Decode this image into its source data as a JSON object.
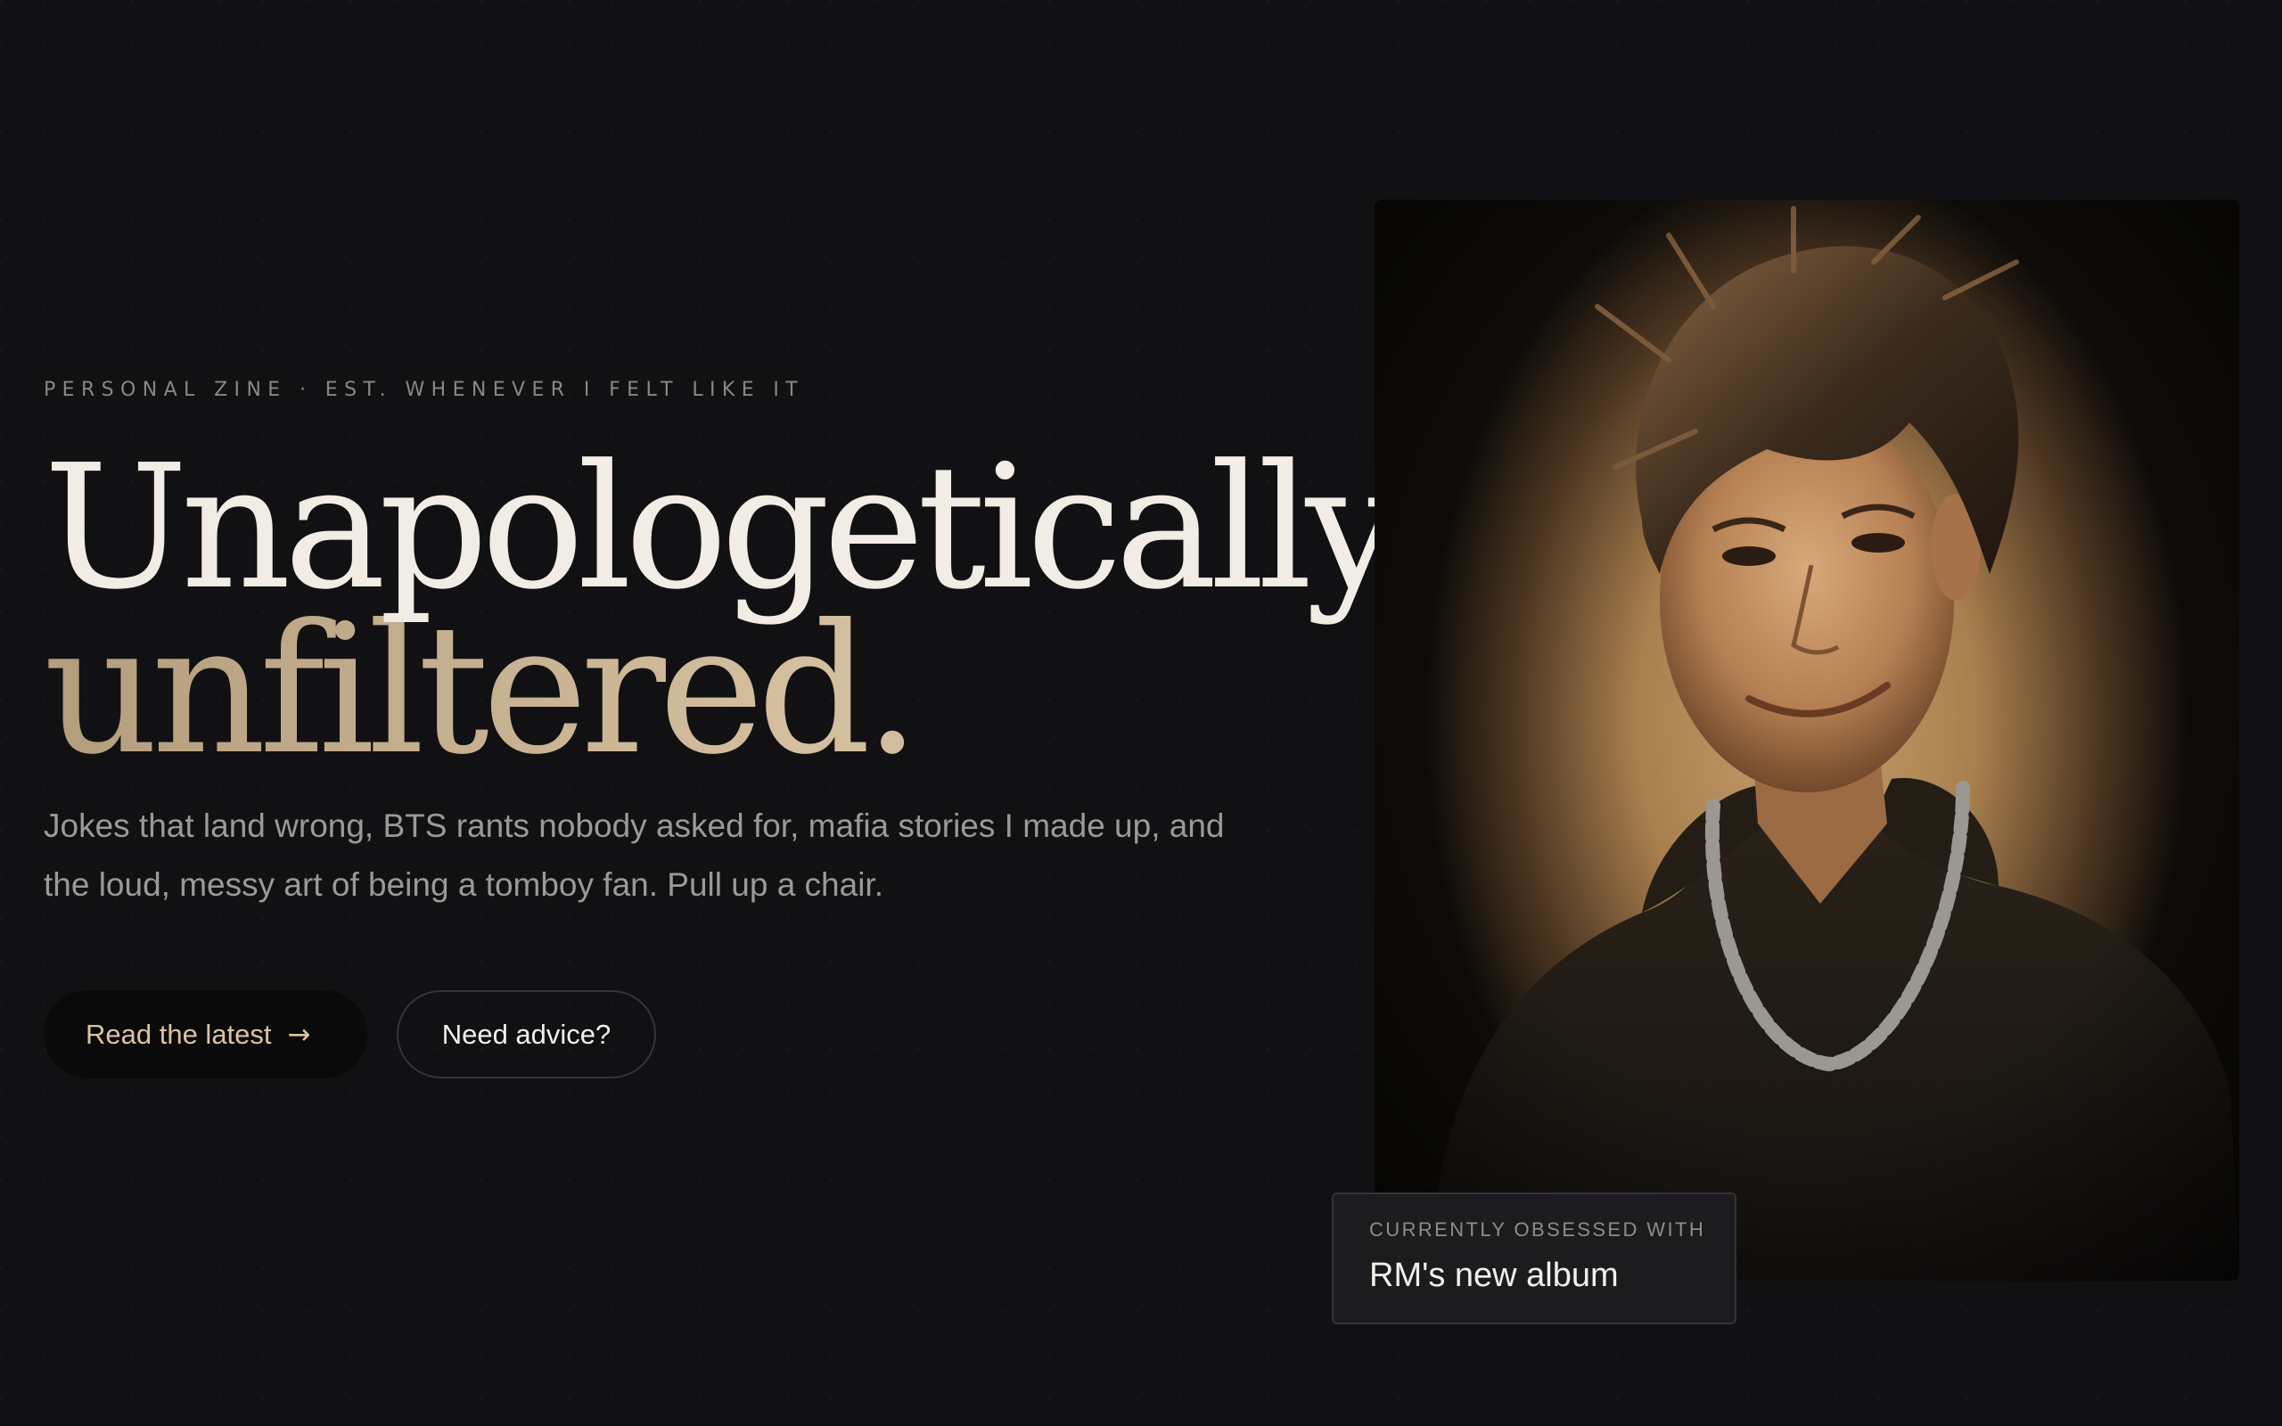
{
  "hero": {
    "eyebrow": "PERSONAL ZINE · EST. WHENEVER I FELT LIKE IT",
    "headline_line1": "Unapologetically",
    "headline_line2": "unfiltered.",
    "intro": "Jokes that land wrong, BTS rants nobody asked for, mafia stories I made up, and the loud, messy art of being a tomboy fan. Pull up a chair.",
    "primary_button": "Read the latest",
    "primary_button_icon": "→",
    "secondary_button": "Need advice?"
  },
  "obsession": {
    "label": "CURRENTLY OBSESSED WITH",
    "value": "RM's new album"
  },
  "colors": {
    "background": "#111113",
    "accent_gold": "#d4bf9f",
    "headline_light": "#f1ece4",
    "card_background": "#1c1c1f"
  }
}
